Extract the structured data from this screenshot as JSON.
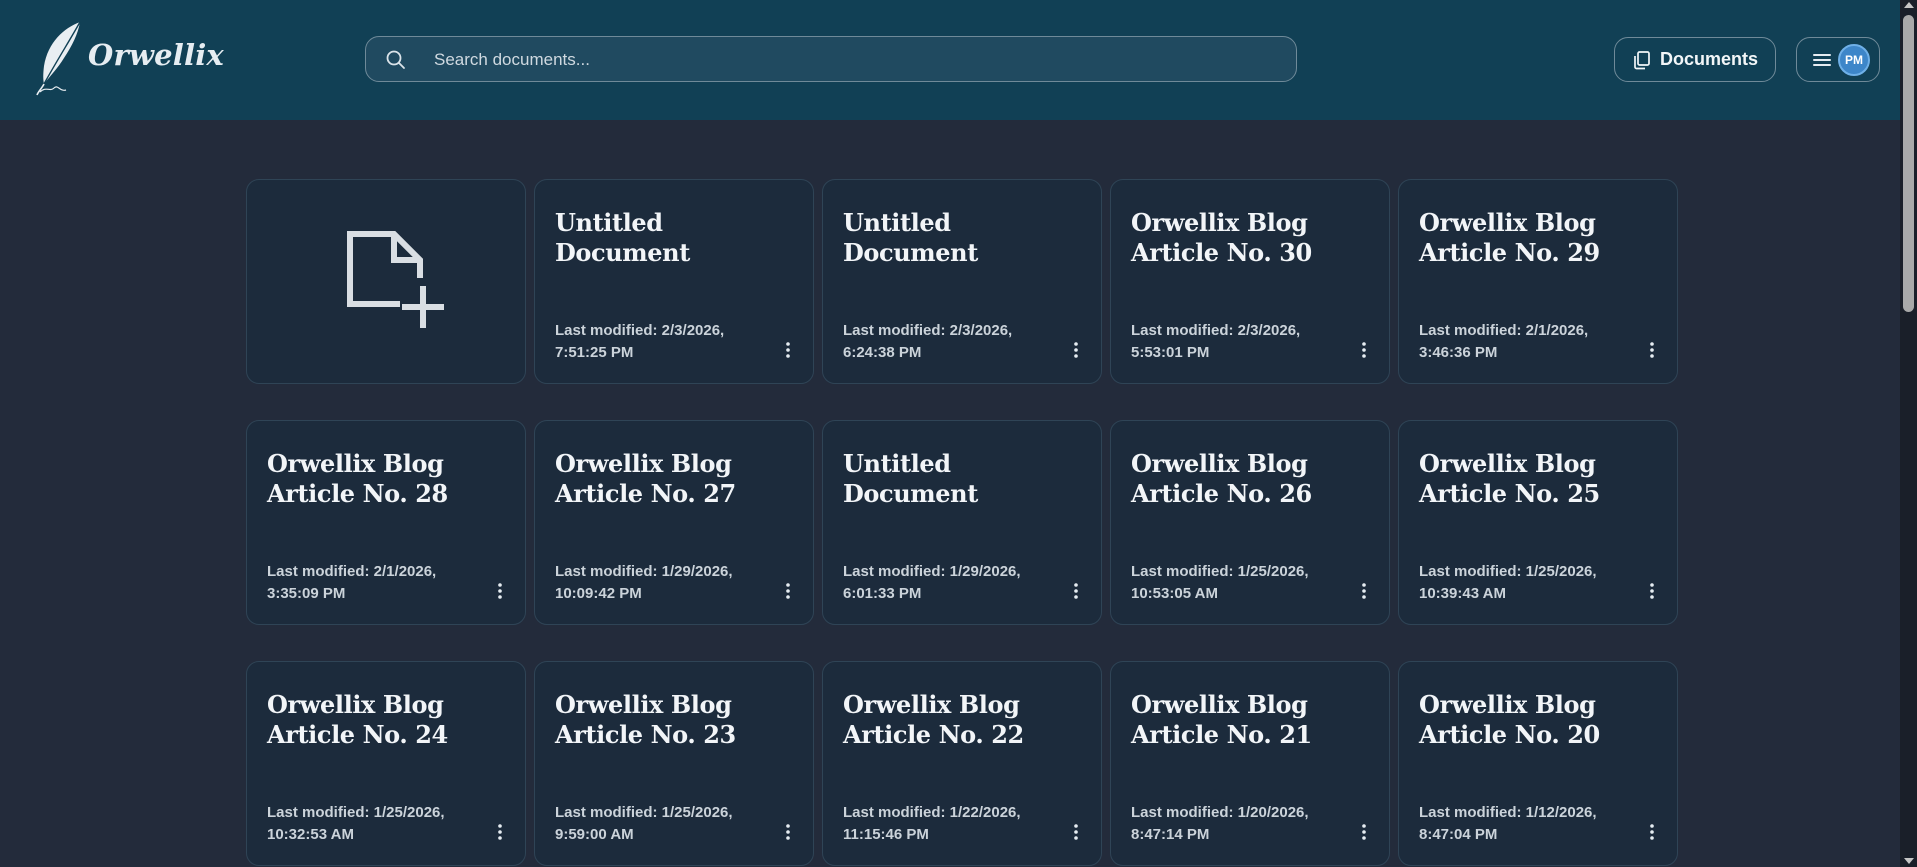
{
  "app": {
    "name": "Orwellix"
  },
  "search": {
    "placeholder": "Search documents..."
  },
  "header": {
    "documents_label": "Documents",
    "avatar_initials": "PM"
  },
  "icons": {
    "logo": "feather-quill-icon",
    "search": "search-icon",
    "documents": "copy-documents-icon",
    "menu": "hamburger-menu-icon",
    "new_document": "new-file-plus-icon",
    "card_menu": "kebab-vertical-icon"
  },
  "documents": [
    {
      "title": "Untitled Document",
      "modified": "Last modified: 2/3/2026, 7:51:25 PM"
    },
    {
      "title": "Untitled Document",
      "modified": "Last modified: 2/3/2026, 6:24:38 PM"
    },
    {
      "title": "Orwellix Blog Article No. 30",
      "modified": "Last modified: 2/3/2026, 5:53:01 PM"
    },
    {
      "title": "Orwellix Blog Article No. 29",
      "modified": "Last modified: 2/1/2026, 3:46:36 PM"
    },
    {
      "title": "Orwellix Blog Article No. 28",
      "modified": "Last modified: 2/1/2026, 3:35:09 PM"
    },
    {
      "title": "Orwellix Blog Article No. 27",
      "modified": "Last modified: 1/29/2026, 10:09:42 PM"
    },
    {
      "title": "Untitled Document",
      "modified": "Last modified: 1/29/2026, 6:01:33 PM"
    },
    {
      "title": "Orwellix Blog Article No. 26",
      "modified": "Last modified: 1/25/2026, 10:53:05 AM"
    },
    {
      "title": "Orwellix Blog Article No. 25",
      "modified": "Last modified: 1/25/2026, 10:39:43 AM"
    },
    {
      "title": "Orwellix Blog Article No. 24",
      "modified": "Last modified: 1/25/2026, 10:32:53 AM"
    },
    {
      "title": "Orwellix Blog Article No. 23",
      "modified": "Last modified: 1/25/2026, 9:59:00 AM"
    },
    {
      "title": "Orwellix Blog Article No. 22",
      "modified": "Last modified: 1/22/2026, 11:15:46 PM"
    },
    {
      "title": "Orwellix Blog Article No. 21",
      "modified": "Last modified: 1/20/2026, 8:47:14 PM"
    },
    {
      "title": "Orwellix Blog Article No. 20",
      "modified": "Last modified: 1/12/2026, 8:47:04 PM"
    }
  ]
}
